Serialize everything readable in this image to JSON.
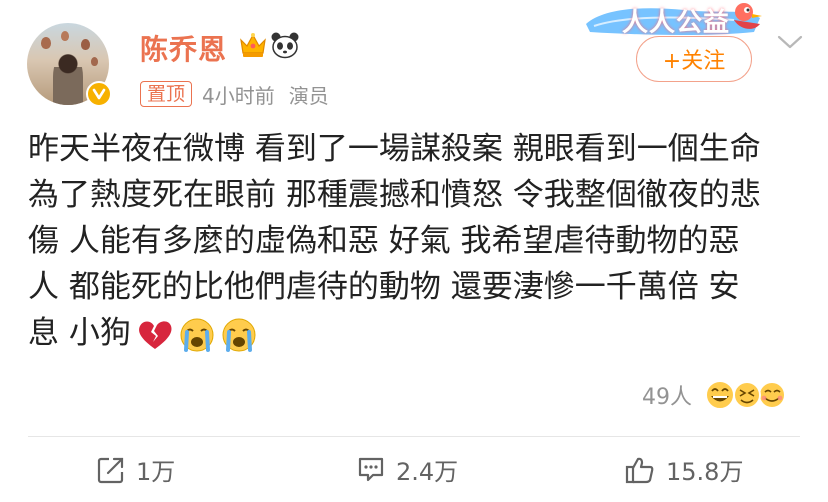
{
  "post": {
    "author": {
      "name": "陈乔恩",
      "badges": [
        "crown-icon",
        "panda-icon"
      ]
    },
    "pin_label": "置顶",
    "time": "4小时前",
    "identity": "演员",
    "campaign_label": "人人公益",
    "follow_label": "+关注",
    "content_lines": [
      "昨天半夜在微博 看到了一場謀殺案 親眼看到一個生命",
      "為了熱度死在眼前 那種震撼和憤怒 令我整個徹夜的悲",
      "傷 人能有多麼的虛偽和惡 好氣 我希望虐待動物的惡",
      "人 都能死的比他們虐待的動物 還要淒慘一千萬倍 安",
      "息 小狗"
    ],
    "content_emojis": [
      "broken-heart-icon",
      "crying-face-icon",
      "crying-face-icon"
    ],
    "reaction_count": "49人",
    "reaction_icons": [
      "laughing-face-icon",
      "squinting-face-icon",
      "smiling-face-icon"
    ]
  },
  "actions": {
    "repost": {
      "icon": "share-icon",
      "count": "1万"
    },
    "comment": {
      "icon": "comment-icon",
      "count": "2.4万"
    },
    "like": {
      "icon": "thumbs-up-icon",
      "count": "15.8万"
    }
  },
  "colors": {
    "name": "#eb7350",
    "follow_text": "#ff8200",
    "meta": "#939393",
    "verify_badge": "#f7b100"
  }
}
